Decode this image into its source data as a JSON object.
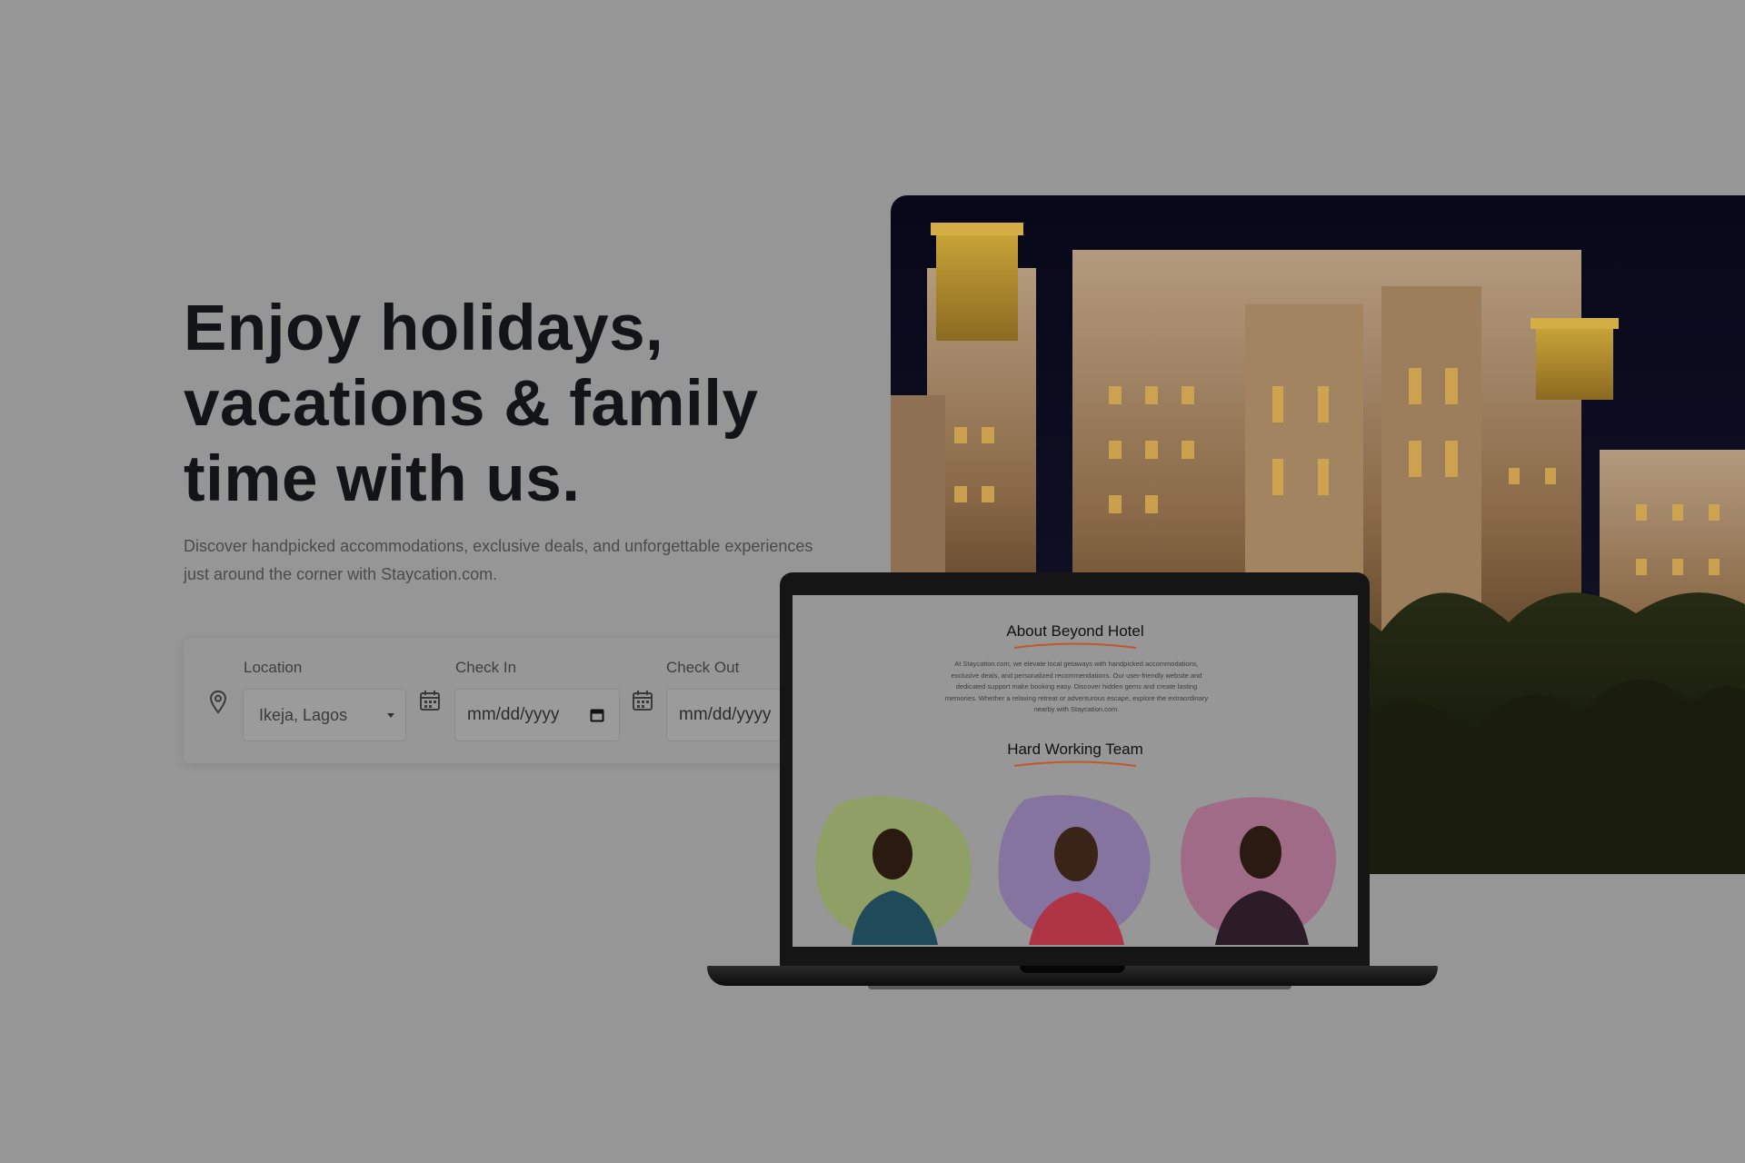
{
  "hero": {
    "headline_lines": [
      "Enjoy holidays,",
      "vacations & family",
      "time with us."
    ],
    "description": "Discover handpicked accommodations, exclusive deals, and unforgettable experiences just around the corner with Staycation.com."
  },
  "booking": {
    "location": {
      "label": "Location",
      "value": "Ikeja, Lagos",
      "icon": "map-pin-icon"
    },
    "check_in": {
      "label": "Check In",
      "placeholder": "mm/dd/yyyy",
      "icon": "calendar-icon"
    },
    "check_out": {
      "label": "Check Out",
      "placeholder": "mm/dd/yyyy",
      "icon": "calendar-icon"
    }
  },
  "laptop_screen": {
    "about_title": "About Beyond Hotel",
    "about_text": "At Staycation.com, we elevate local getaways with handpicked accommodations, exclusive deals, and personalized recommendations. Our user-friendly website and dedicated support make booking easy. Discover hidden gems and create lasting memories. Whether a relaxing retreat or adventurous escape, explore the extraordinary nearby with Staycation.com.",
    "team_title": "Hard Working Team",
    "team_blob_colors": [
      "#8f9f66",
      "#8574a0",
      "#a06b86"
    ],
    "accent_color": "#c1582a"
  }
}
